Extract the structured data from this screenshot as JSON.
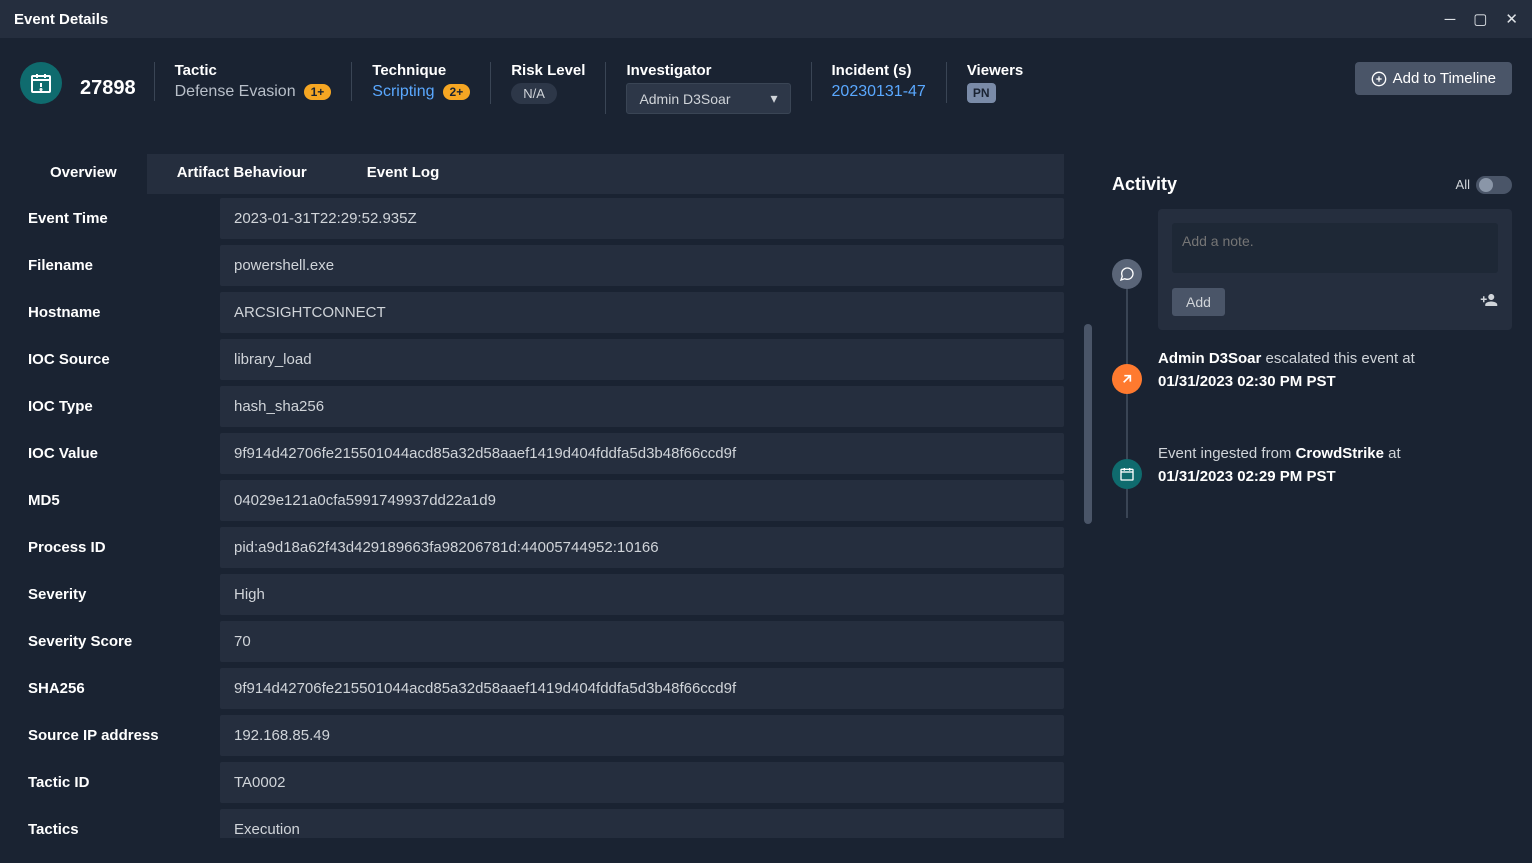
{
  "window": {
    "title": "Event Details"
  },
  "header": {
    "event_id": "27898",
    "tactic_label": "Tactic",
    "tactic_value": "Defense Evasion",
    "tactic_badge": "1+",
    "technique_label": "Technique",
    "technique_value": "Scripting",
    "technique_badge": "2+",
    "risk_label": "Risk Level",
    "risk_value": "N/A",
    "investigator_label": "Investigator",
    "investigator_value": "Admin D3Soar",
    "incident_label": "Incident (s)",
    "incident_value": "20230131-47",
    "viewers_label": "Viewers",
    "viewers_value": "PN",
    "add_timeline_label": "Add to Timeline"
  },
  "tabs": {
    "overview": "Overview",
    "artifact": "Artifact Behaviour",
    "eventlog": "Event Log"
  },
  "details": [
    {
      "label": "Event Time",
      "value": "2023-01-31T22:29:52.935Z"
    },
    {
      "label": "Filename",
      "value": "powershell.exe"
    },
    {
      "label": "Hostname",
      "value": "ARCSIGHTCONNECT"
    },
    {
      "label": "IOC Source",
      "value": "library_load"
    },
    {
      "label": "IOC Type",
      "value": "hash_sha256"
    },
    {
      "label": "IOC Value",
      "value": "9f914d42706fe215501044acd85a32d58aaef1419d404fddfa5d3b48f66ccd9f"
    },
    {
      "label": "MD5",
      "value": "04029e121a0cfa5991749937dd22a1d9"
    },
    {
      "label": "Process ID",
      "value": "pid:a9d18a62f43d429189663fa98206781d:44005744952:10166"
    },
    {
      "label": "Severity",
      "value": "High"
    },
    {
      "label": "Severity Score",
      "value": "70"
    },
    {
      "label": "SHA256",
      "value": "9f914d42706fe215501044acd85a32d58aaef1419d404fddfa5d3b48f66ccd9f"
    },
    {
      "label": "Source IP address",
      "value": "192.168.85.49"
    },
    {
      "label": "Tactic ID",
      "value": "TA0002"
    },
    {
      "label": "Tactics",
      "value": "Execution"
    }
  ],
  "activity": {
    "title": "Activity",
    "toggle_label": "All",
    "note_placeholder": "Add a note.",
    "add_label": "Add",
    "entries": {
      "escalated_user": "Admin D3Soar",
      "escalated_text": " escalated this event at ",
      "escalated_time": "01/31/2023 02:30 PM PST",
      "ingested_text": "Event ingested from ",
      "ingested_source": "CrowdStrike",
      "ingested_at": " at ",
      "ingested_time": "01/31/2023 02:29 PM PST"
    }
  }
}
